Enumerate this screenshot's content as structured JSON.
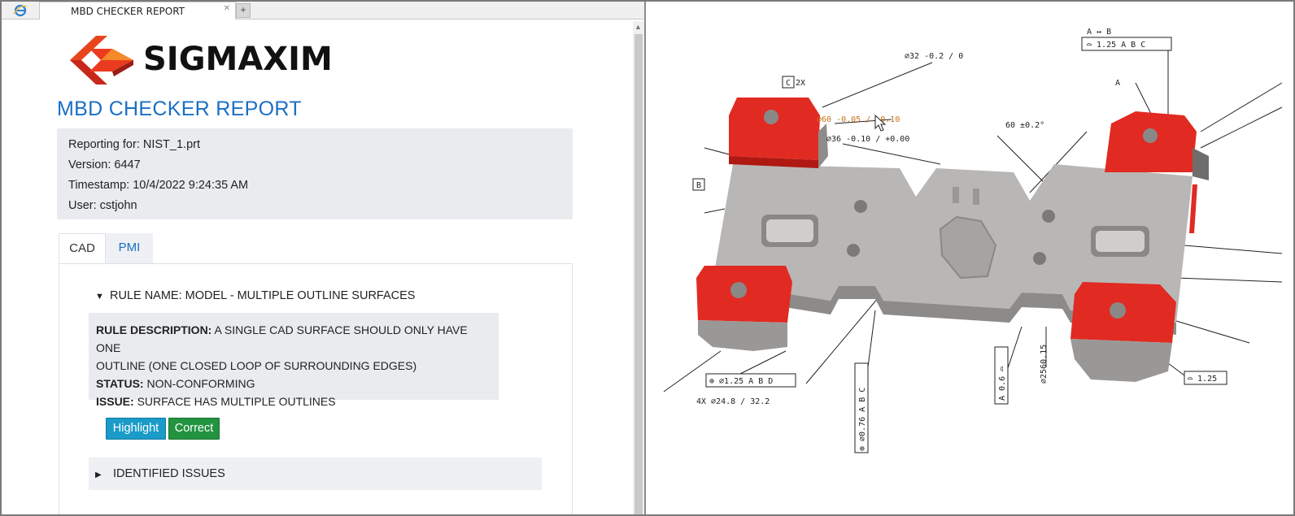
{
  "browser": {
    "tab_title": "MBD CHECKER REPORT",
    "tab_close_glyph": "✕",
    "new_tab_glyph": "+"
  },
  "logo": {
    "text": "SIGMAXIM"
  },
  "report": {
    "title": "MBD CHECKER REPORT",
    "info": [
      "Reporting for: NIST_1.prt",
      "Version: 6447",
      "Timestamp: 10/4/2022 9:24:35 AM",
      "User: cstjohn"
    ]
  },
  "tabs": {
    "cad": "CAD",
    "pmi": "PMI"
  },
  "rule": {
    "name": "RULE NAME: MODEL - MULTIPLE OUTLINE SURFACES",
    "description_label": "RULE DESCRIPTION:",
    "description_text": "A SINGLE CAD SURFACE SHOULD ONLY HAVE ONE",
    "description_text_2": "OUTLINE (ONE CLOSED LOOP OF SURROUNDING EDGES)",
    "status_label": "STATUS:",
    "status_text": "NON-CONFORMING",
    "issue_label": "ISSUE:",
    "issue_text": "SURFACE HAS MULTIPLE OUTLINES"
  },
  "buttons": {
    "highlight": "Highlight",
    "correct": "Correct"
  },
  "identified_issues": "IDENTIFIED ISSUES",
  "colors": {
    "accent_blue": "#1a6fc4",
    "highlight_button": "#1a9bc8",
    "correct_button": "#22933f",
    "highlighted_surface": "#e12a22",
    "part_gray": "#b8b6b4"
  },
  "cad_view": {
    "annotations": {
      "dim_a_b": "A ↔ B",
      "frame_top": "⌓ 1.25 A B C",
      "label_a": "A",
      "label_c2x": "C  2X",
      "dim_32": "∅32 -0.2 / 0",
      "dim_orange": "∅60 -0.05 / +0.10",
      "dim_60": "60 ±0.2°",
      "dim_left2": "∅36 -0.10 / +0.00",
      "label_b": "B",
      "frame_left": "⊕ ∅1.25 A B D",
      "dim_4x": "4X ∅24.8 / 32.2",
      "frame_bottom": "⊕ ∅0.76 A B C",
      "frame_a": "A 0.6 ⌓",
      "dim_15": "∅2560.15",
      "frame_right": "⌓ 1.25"
    }
  }
}
